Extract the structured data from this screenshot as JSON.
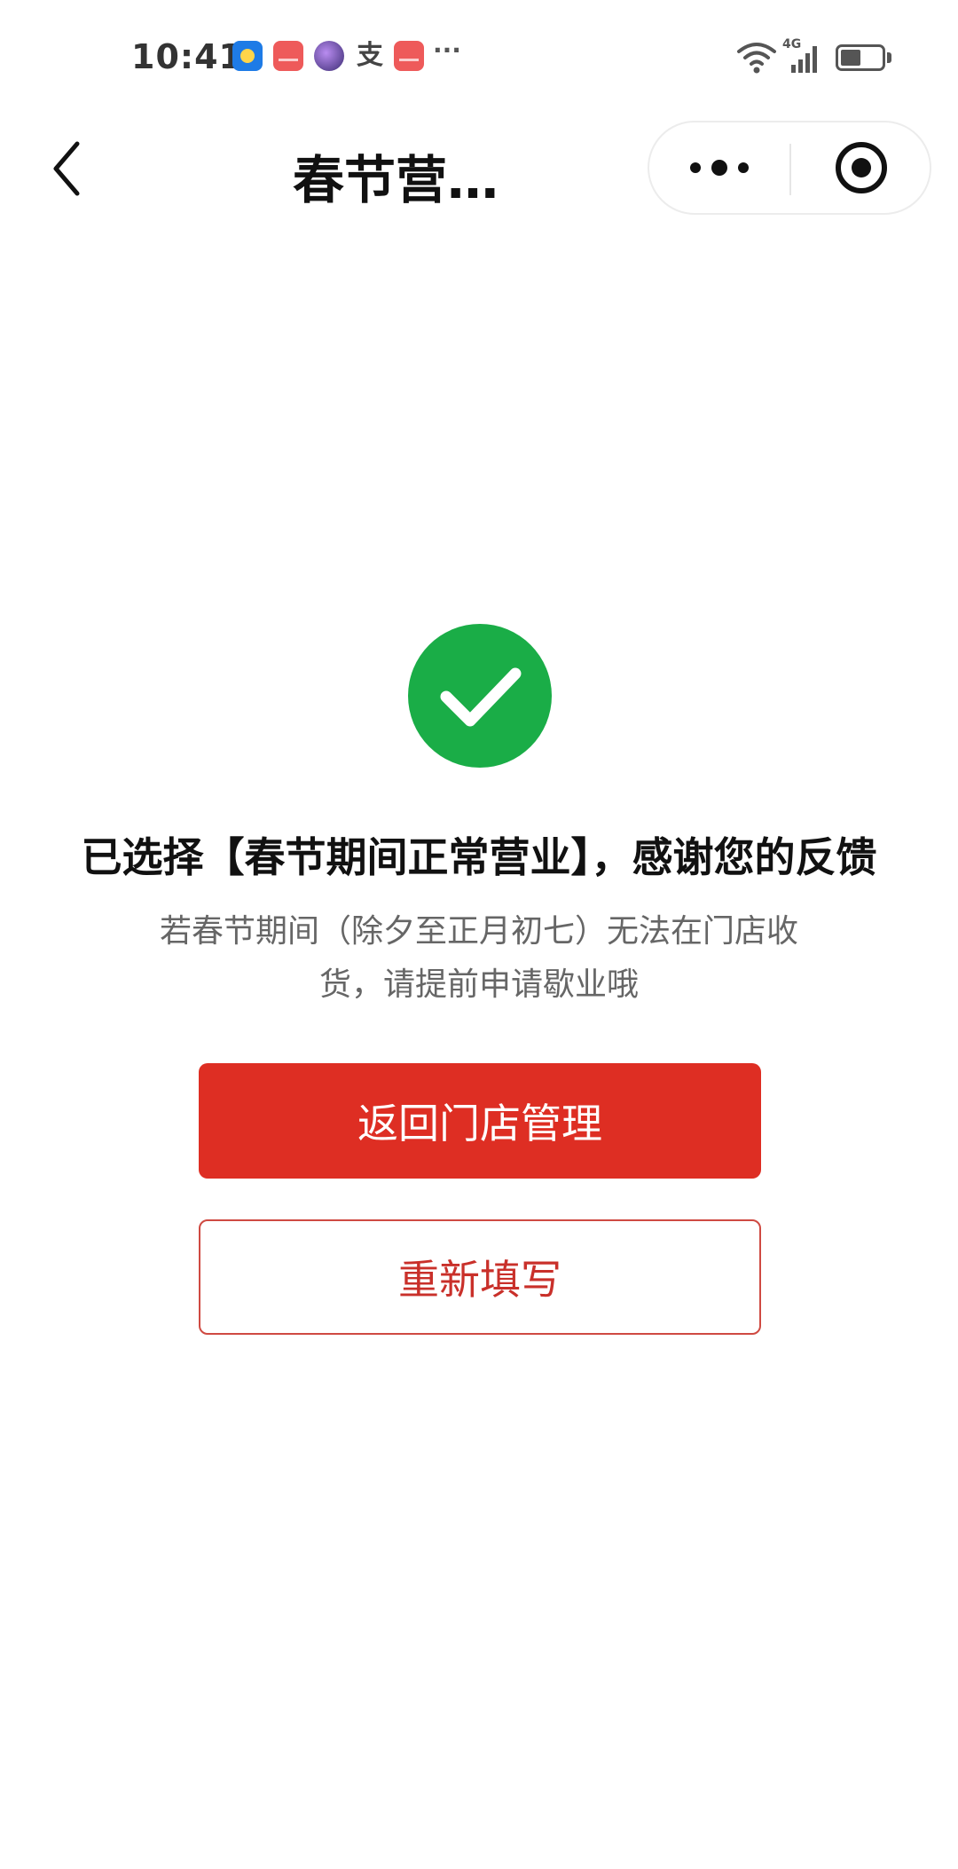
{
  "status_bar": {
    "time": "10:41",
    "notification_icons": [
      "weather-icon",
      "huawei-store-icon",
      "game-icon",
      "alipay-icon",
      "huawei-store-icon",
      "more-icon"
    ],
    "alipay_glyph": "支",
    "more_glyph": "···",
    "network_label": "4G",
    "icons": [
      "wifi-icon",
      "cellular-signal-icon",
      "battery-icon"
    ]
  },
  "nav": {
    "title": "春节营…",
    "back_icon": "chevron-left-icon",
    "menu_icon": "more-dots-icon",
    "close_icon": "target-close-icon"
  },
  "result": {
    "icon": "check-circle-icon",
    "icon_color": "#1aad47",
    "title": "已选择【春节期间正常营业】，感谢您的反馈",
    "desc_line1": "若春节期间（除夕至正月初七）无法在门店收",
    "desc_line2": "货，请提前申请歇业哦"
  },
  "buttons": {
    "primary_label": "返回门店管理",
    "primary_color": "#de2e23",
    "secondary_label": "重新填写",
    "secondary_color": "#c9302a"
  }
}
